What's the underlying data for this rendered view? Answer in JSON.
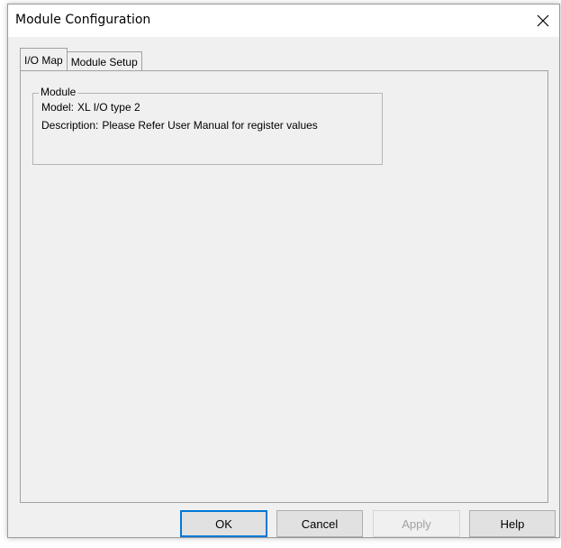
{
  "dialog": {
    "title": "Module Configuration",
    "close_icon": "close-icon"
  },
  "tabs": [
    {
      "label": "I/O Map",
      "active": true
    },
    {
      "label": "Module Setup",
      "active": false
    }
  ],
  "module_group": {
    "legend": "Module",
    "model_label": "Model:",
    "model_value": "XL I/O type 2",
    "description_label": "Description:",
    "description_value": "Please Refer User Manual for register values"
  },
  "buttons": {
    "ok": "OK",
    "cancel": "Cancel",
    "apply": "Apply",
    "help": "Help"
  },
  "colors": {
    "dialog_bg": "#f0f0f0",
    "focus_border": "#0078d7",
    "disabled_text": "#a0a0a0"
  }
}
